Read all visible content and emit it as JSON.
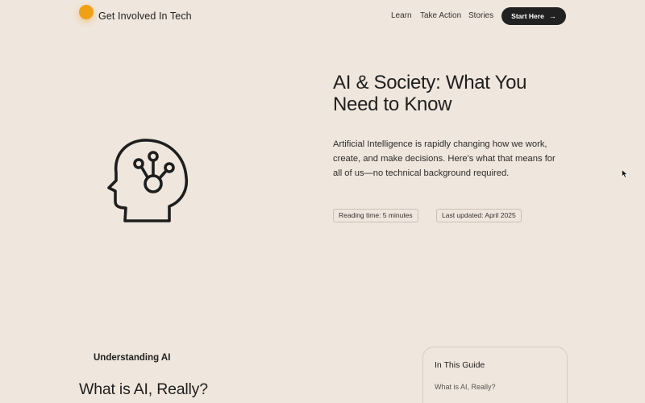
{
  "header": {
    "brand": "Get Involved In Tech",
    "nav": [
      "Learn",
      "Take Action",
      "Stories"
    ],
    "cta_label": "Start Here",
    "accent_color": "#f0a017"
  },
  "hero": {
    "title": "AI & Society: What You Need to Know",
    "description": "Artificial Intelligence is rapidly changing how we work, create, and make decisions. Here's what that means for all of us—no technical background required.",
    "reading_time": "Reading time: 5 minutes",
    "last_updated": "Last updated: April 2025",
    "illustration_icon": "ai-head-circuit-icon"
  },
  "section": {
    "label": "Understanding AI",
    "title": "What is AI, Really?"
  },
  "toc": {
    "title": "In This Guide",
    "items": [
      "What is AI, Really?"
    ]
  }
}
